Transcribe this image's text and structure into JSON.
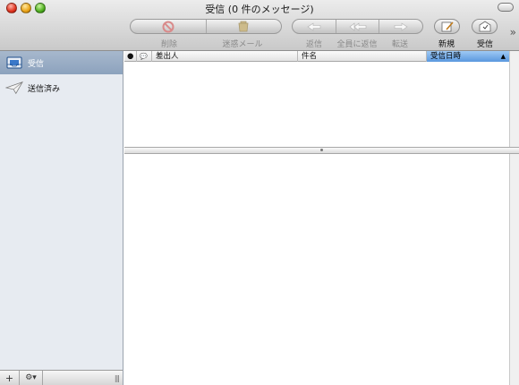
{
  "window": {
    "title": "受信 (0 件のメッセージ)"
  },
  "toolbar": {
    "delete_label": "削除",
    "junk_label": "迷惑メール",
    "reply_label": "返信",
    "reply_all_label": "全員に返信",
    "forward_label": "転送",
    "new_label": "新規",
    "get_mail_label": "受信",
    "more_glyph": "»"
  },
  "sidebar": {
    "items": [
      {
        "label": "受信",
        "icon": "inbox-icon",
        "selected": true
      },
      {
        "label": "送信済み",
        "icon": "sent-icon",
        "selected": false
      }
    ],
    "footer": {
      "add": "+",
      "action": "⚙▾",
      "grip": "|||"
    }
  },
  "message_list": {
    "columns": [
      {
        "label": "●",
        "kind": "status"
      },
      {
        "label": "💬",
        "kind": "reply"
      },
      {
        "label": "差出人",
        "kind": "from"
      },
      {
        "label": "件名",
        "kind": "subject"
      },
      {
        "label": "受信日時",
        "kind": "date",
        "sorted": true,
        "sort_glyph": "▲"
      }
    ],
    "rows": []
  },
  "colors": {
    "sort_header": "#5a98de",
    "sidebar_selected": "#8ca2bd",
    "sidebar_bg": "#e7ebf1"
  }
}
